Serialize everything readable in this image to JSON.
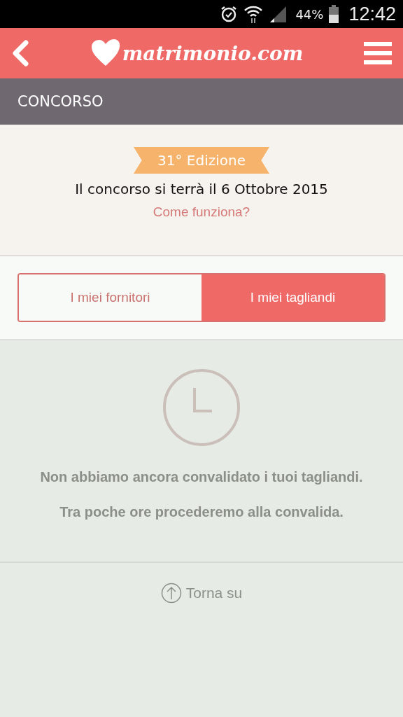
{
  "status_bar": {
    "battery": "44%",
    "time": "12:42"
  },
  "header": {
    "logo": "matrimonio.com"
  },
  "section": {
    "title": "CONCORSO"
  },
  "info": {
    "badge": "31° Edizione",
    "date": "Il concorso si terrà il 6 Ottobre 2015",
    "link": "Come funziona?"
  },
  "tabs": [
    {
      "label": "I miei fornitori",
      "selected": false
    },
    {
      "label": "I miei tagliandi",
      "selected": true
    }
  ],
  "empty_state": {
    "message": "Non abbiamo ancora convalidato i tuoi tagliandi.",
    "note": "Tra poche ore procederemo alla convalida."
  },
  "back_to_top": "Torna su"
}
